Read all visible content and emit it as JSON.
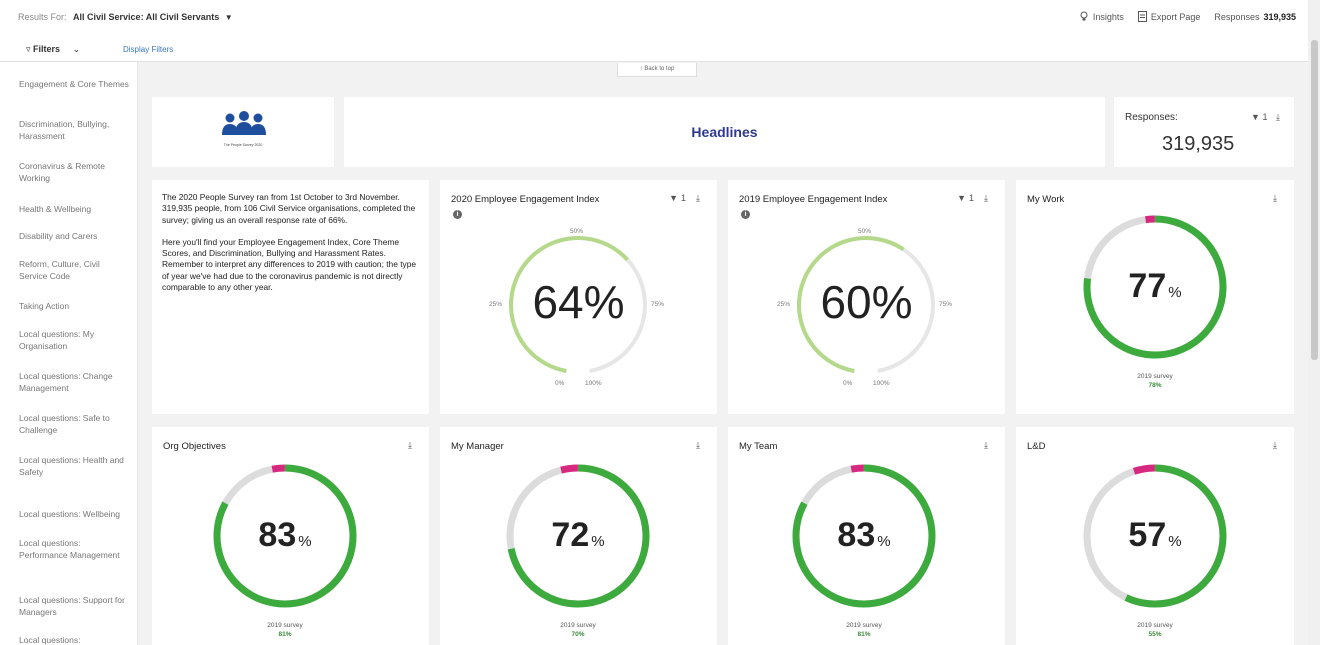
{
  "header": {
    "results_for_label": "Results For:",
    "results_scope": "All Civil Service: All Civil Servants",
    "insights_label": "Insights",
    "export_label": "Export Page",
    "responses_label": "Responses",
    "responses_value": "319,935"
  },
  "filterbar": {
    "filters_label": "Filters",
    "display_filters_label": "Display Filters"
  },
  "back_to_top_label": "↑ Back to top",
  "sidebar": {
    "items": [
      "Engagement & Core Themes",
      "Discrimination, Bullying, Harassment",
      "Coronavirus & Remote Working",
      "Health & Wellbeing",
      "Disability and Carers",
      "Reform, Culture, Civil Service Code",
      "Taking Action",
      "Local questions: My Organisation",
      "Local questions: Change Management",
      "Local questions: Safe to Challenge",
      "Local questions: Health and Safety",
      "Local questions: Wellbeing",
      "Local questions: Performance Management",
      "Local questions: Support for Managers",
      "Local questions:"
    ]
  },
  "logo": {
    "caption": "The People Survey 2020"
  },
  "headline": {
    "title": "Headlines"
  },
  "responses_card": {
    "label": "Responses:",
    "value": "319,935",
    "filter_count": "1"
  },
  "intro": {
    "paragraph1": "The 2020 People Survey ran from 1st October to 3rd November. 319,935 people, from 106 Civil Service organisations, completed the survey; giving us an overall response rate of 66%.",
    "paragraph2": "Here you'll find your Employee Engagement Index, Core Theme Scores, and Discrimination, Bullying and Harassment Rates. Remember to interpret any differences to 2019 with caution; the type of year we've had due to the coronavirus pandemic is not directly comparable to any other year."
  },
  "gauge_labels": {
    "p0": "0%",
    "p25": "25%",
    "p50": "50%",
    "p75": "75%",
    "p100": "100%"
  },
  "gauges": [
    {
      "title": "2020 Employee Engagement Index",
      "value": 64,
      "display": "64%",
      "filter_count": "1"
    },
    {
      "title": "2019 Employee Engagement Index",
      "value": 60,
      "display": "60%",
      "filter_count": "1"
    }
  ],
  "rings": [
    {
      "title": "My Work",
      "value": "77",
      "unit": "%",
      "score": 77,
      "change": 2,
      "survey_label": "2019 survey",
      "survey_value": "78%"
    },
    {
      "title": "Org Objectives",
      "value": "83",
      "unit": "%",
      "score": 83,
      "change": 3,
      "survey_label": "2019 survey",
      "survey_value": "81%"
    },
    {
      "title": "My Manager",
      "value": "72",
      "unit": "%",
      "score": 72,
      "change": 4,
      "survey_label": "2019 survey",
      "survey_value": "70%"
    },
    {
      "title": "My Team",
      "value": "83",
      "unit": "%",
      "score": 83,
      "change": 3,
      "survey_label": "2019 survey",
      "survey_value": "81%"
    },
    {
      "title": "L&D",
      "value": "57",
      "unit": "%",
      "score": 57,
      "change": 5,
      "survey_label": "2019 survey",
      "survey_value": "55%"
    }
  ],
  "colors": {
    "ring_green": "#3daa3d",
    "ring_pink": "#d6287f",
    "ring_grey": "#dcdcdc",
    "gauge_green": "#b5d98a",
    "gauge_grey": "#e6e6e6",
    "accent_blue": "#2d3a8c"
  },
  "icons": {
    "filter": "filter-icon",
    "download": "download-icon",
    "info": "info-icon",
    "insights": "lightbulb-icon",
    "export": "document-icon"
  }
}
